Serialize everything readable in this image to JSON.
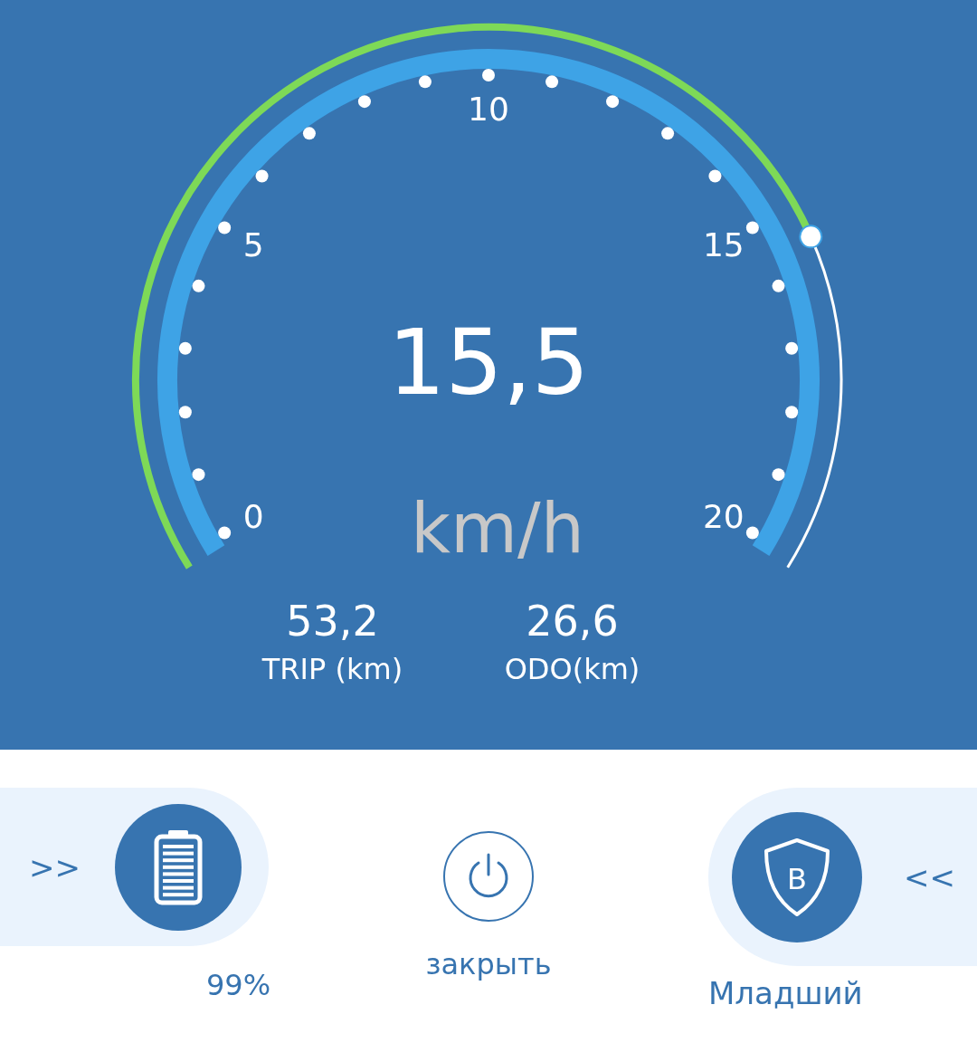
{
  "gauge": {
    "ticks": [
      "0",
      "5",
      "10",
      "15",
      "20"
    ],
    "speed": "15,5",
    "unit": "km/h"
  },
  "stats": [
    {
      "value": "53,2",
      "label": "TRIP (km)"
    },
    {
      "value": "26,6",
      "label": "ODO(km)"
    }
  ],
  "controls": {
    "battery": {
      "arrow": ">>",
      "reading": "99%"
    },
    "power": {
      "label": "закрыть"
    },
    "mode": {
      "letter": "B",
      "arrow": "<<",
      "label": "Младший"
    }
  }
}
